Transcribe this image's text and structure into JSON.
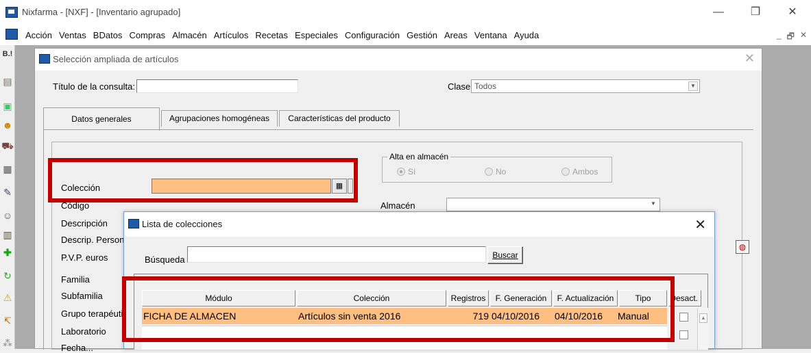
{
  "window": {
    "title": "Nixfarma - [NXF] - [Inventario agrupado]",
    "controls": {
      "minimize": "—",
      "restore": "❐",
      "close": "✕"
    }
  },
  "menu": {
    "items": [
      "Acción",
      "Ventas",
      "BDatos",
      "Compras",
      "Almacén",
      "Artículos",
      "Recetas",
      "Especiales",
      "Configuración",
      "Gestión",
      "Areas",
      "Ventana",
      "Ayuda"
    ],
    "mdi_controls": [
      "_",
      "🗗",
      "✕"
    ]
  },
  "toolbar": {
    "icons": [
      "printer-icon",
      "document-icon",
      "person-icon",
      "cart-icon",
      "truck-icon",
      "pencil-icon",
      "people-icon",
      "register-icon",
      "add-icon",
      "refresh-icon",
      "warning-icon",
      "user-arrow-icon",
      "more-icon"
    ],
    "top_icon_label": "B.!"
  },
  "selection_dialog": {
    "title": "Selección ampliada de artículos",
    "query_title_label": "Título de la consulta:",
    "query_title_value": "",
    "clase_label": "Clase",
    "clase_value": "Todos",
    "tabs": [
      "Datos generales",
      "Agrupaciones homogéneas",
      "Características del producto"
    ],
    "coleccion_label": "Colección",
    "coleccion_value": "",
    "fields": [
      "Código",
      "Descripción",
      "Descrip. Persona",
      "P.V.P. euros",
      "Familia",
      "Subfamilia",
      "Grupo terapéutic",
      "Laboratorio",
      "Fecha..."
    ],
    "alta_label": "Alta en almacén",
    "radios": [
      {
        "label": "Sí",
        "checked": true
      },
      {
        "label": "No",
        "checked": false
      },
      {
        "label": "Ambos",
        "checked": false
      }
    ],
    "almacen_label": "Almacén",
    "almacen_value": ""
  },
  "list_dialog": {
    "title": "Lista de colecciones",
    "search_label": "Búsqueda",
    "search_value": "",
    "search_button": "Buscar",
    "columns": [
      "Módulo",
      "Colección",
      "Registros",
      "F. Generación",
      "F. Actualización",
      "Tipo",
      "Desact."
    ],
    "rows": [
      {
        "modulo": "FICHA DE ALMACEN",
        "coleccion": "Artículos sin venta 2016",
        "registros": "719",
        "f_generacion": "04/10/2016",
        "f_actualizacion": "04/10/2016",
        "tipo": "Manual"
      }
    ]
  },
  "colors": {
    "highlight": "#c00000",
    "selected_row": "#ffbe82",
    "coleccion_field": "#ffbe82"
  }
}
